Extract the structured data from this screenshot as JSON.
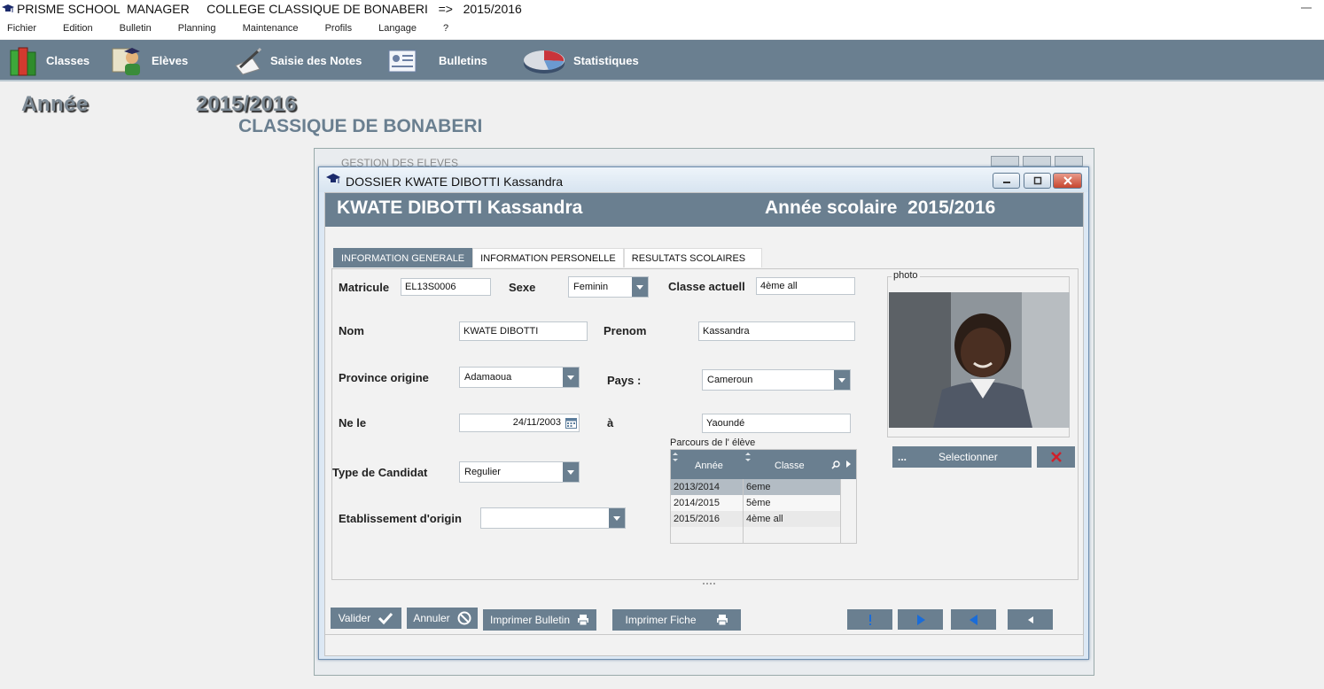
{
  "app": {
    "title": "PRISME SCHOOL  MANAGER     COLLEGE CLASSIQUE DE BONABERI   =>   2015/2016"
  },
  "menu": [
    "Fichier",
    "Edition",
    "Bulletin",
    "Planning",
    "Maintenance",
    "Profils",
    "Langage",
    "?"
  ],
  "toolbar": {
    "classes": "Classes",
    "eleves": "Elèves",
    "saisie": "Saisie des Notes",
    "bulletins": "Bulletins",
    "statistiques": "Statistiques"
  },
  "background": {
    "year_label": "Année",
    "year_value": "2015/2016",
    "school": "CLASSIQUE DE BONABERI"
  },
  "outer_window": {
    "title": "GESTION DES ELEVES"
  },
  "dossier": {
    "window_title": "DOSSIER  KWATE DIBOTTI Kassandra",
    "banner_name": "KWATE DIBOTTI Kassandra",
    "banner_year": "Année scolaire  2015/2016",
    "tabs": [
      "INFORMATION GENERALE",
      "INFORMATION PERSONELLE",
      "RESULTATS SCOLAIRES"
    ],
    "fields": {
      "matricule_label": "Matricule",
      "matricule": "EL13S0006",
      "sexe_label": "Sexe",
      "sexe": "Feminin",
      "classe_label": "Classe actuell",
      "classe": "4ème all",
      "nom_label": "Nom",
      "nom": "KWATE DIBOTTI",
      "prenom_label": "Prenom",
      "prenom": "Kassandra",
      "province_label": "Province origine",
      "province": "Adamaoua",
      "pays_label": "Pays :",
      "pays": "Cameroun",
      "ne_le_label": "Ne le",
      "ne_le": "24/11/2003",
      "a_label": "à",
      "lieu": "Yaoundé",
      "type_label": "Type de Candidat",
      "type": "Regulier",
      "etab_label": "Etablissement d'origin",
      "etab": ""
    },
    "photo": {
      "label": "photo",
      "select_dots": "...",
      "select_label": "Selectionner"
    },
    "parcours": {
      "label": "Parcours de l' élève",
      "col_annee": "Année",
      "col_classe": "Classe",
      "rows": [
        {
          "annee": "2013/2014",
          "classe": "6eme"
        },
        {
          "annee": "2014/2015",
          "classe": "5ème"
        },
        {
          "annee": "2015/2016",
          "classe": "4ème all"
        }
      ]
    },
    "buttons": {
      "valider": "Valider",
      "annuler": "Annuler",
      "imprimer_bulletin": "Imprimer Bulletin",
      "imprimer_fiche": "Imprimer Fiche"
    }
  },
  "colors": {
    "accent": "#6a7f90",
    "selected_row": "#b3bcc4"
  }
}
